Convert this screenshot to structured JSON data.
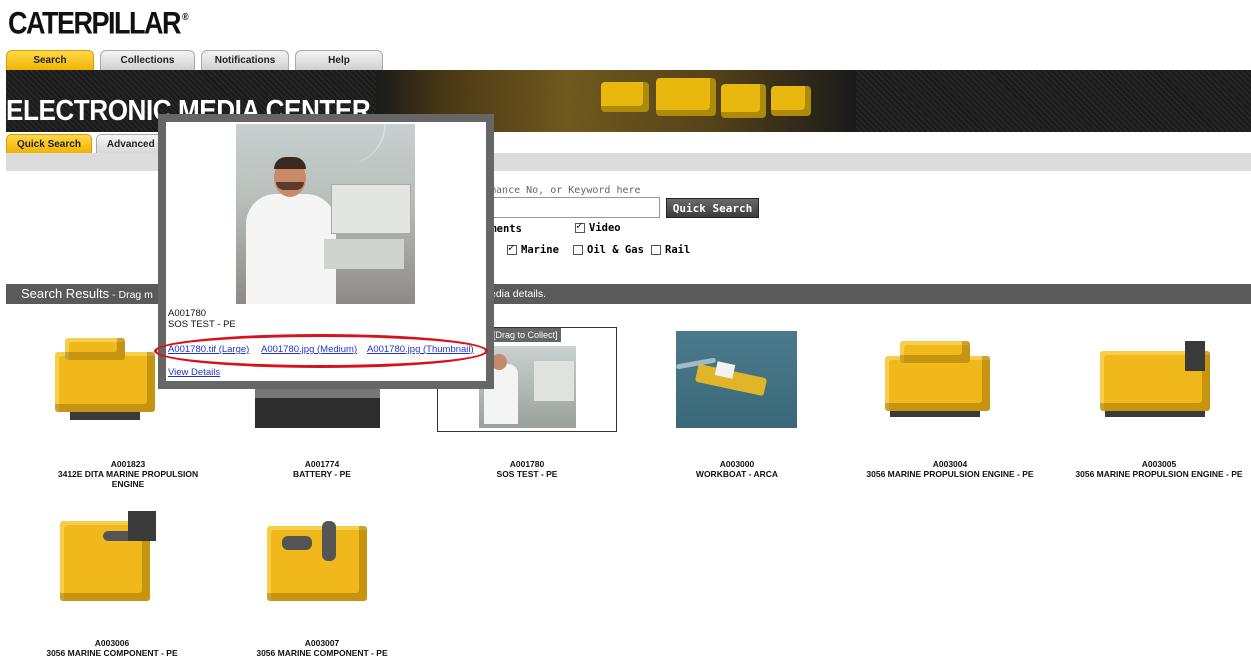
{
  "brand": {
    "logo": "CATERPILLAR",
    "registered": "®"
  },
  "main_tabs": [
    {
      "label": "Search",
      "active": true
    },
    {
      "label": "Collections",
      "active": false
    },
    {
      "label": "Notifications",
      "active": false
    },
    {
      "label": "Help",
      "active": false
    }
  ],
  "banner": {
    "title": "ELECTRONIC MEDIA CENTER"
  },
  "sub_tabs": [
    {
      "label": "Quick Search",
      "active": true
    },
    {
      "label": "Advanced S",
      "active": false
    }
  ],
  "search": {
    "hint_visible": "rmance No, or Keyword here",
    "button_label": "Quick Search",
    "filters_row1": [
      {
        "label": "uments",
        "checked": null
      },
      {
        "label": "Video",
        "checked": true
      }
    ],
    "filters_row2": [
      {
        "label": "Marine",
        "checked": true
      },
      {
        "label": "Oil & Gas",
        "checked": false
      },
      {
        "label": "Rail",
        "checked": false
      }
    ]
  },
  "results_bar": {
    "title": "Search Results",
    "hint_prefix": " - Drag m",
    "hint_suffix": "edia details."
  },
  "results": [
    {
      "id": "A001823",
      "name": "3412E DITA MARINE PROPULSION ENGINE"
    },
    {
      "id": "A001774",
      "name": "BATTERY - PE"
    },
    {
      "id": "A001780",
      "name": "SOS TEST - PE",
      "overlay": "[Drag to Collect]"
    },
    {
      "id": "A003000",
      "name": "WORKBOAT - ARCA"
    },
    {
      "id": "A003004",
      "name": "3056 MARINE PROPULSION ENGINE - PE"
    },
    {
      "id": "A003005",
      "name": "3056 MARINE PROPULSION ENGINE - PE"
    },
    {
      "id": "A003006",
      "name": "3056 MARINE COMPONENT - PE"
    },
    {
      "id": "A003007",
      "name": "3056 MARINE COMPONENT - PE"
    }
  ],
  "popup": {
    "id": "A001780",
    "name": "SOS TEST - PE",
    "links": [
      {
        "label": "A001780.tif (Large)"
      },
      {
        "label": "A001780.jpg (Medium)"
      },
      {
        "label": "A001780.jpg (Thumbnail)"
      }
    ],
    "view_details": "View Details",
    "highlight_color": "#d6121c"
  },
  "colors": {
    "accent_yellow": "#f2b400",
    "dark_banner": "#1a1a1a",
    "results_bar": "#5a5a5a",
    "link": "#2233cc"
  }
}
